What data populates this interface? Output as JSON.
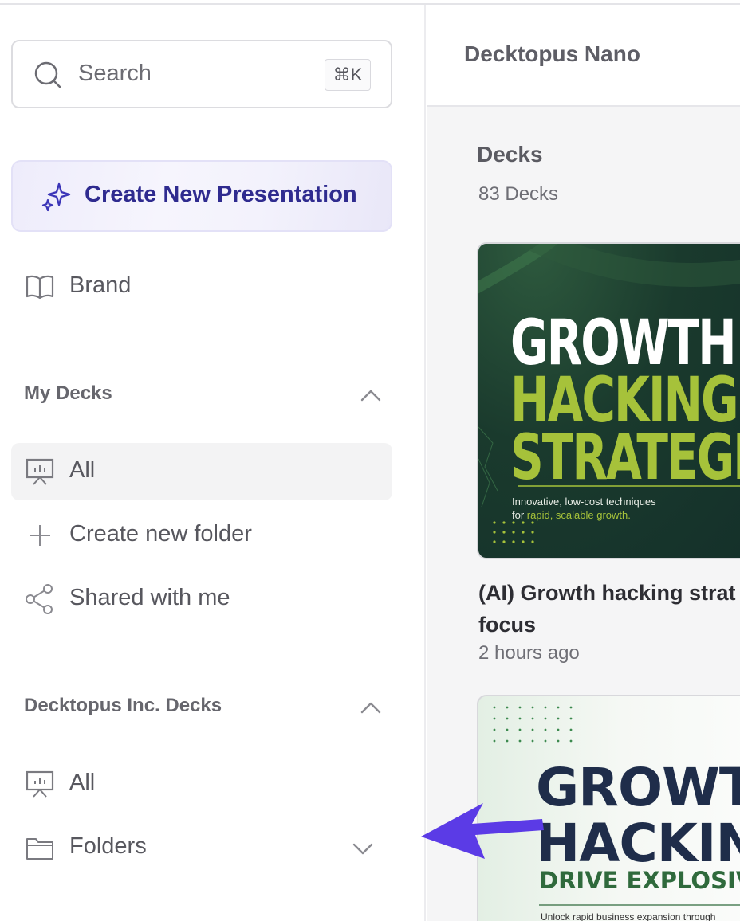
{
  "sidebar": {
    "search": {
      "placeholder": "Search",
      "shortcut": "⌘K"
    },
    "create_button": "Create New Presentation",
    "brand_label": "Brand",
    "my_decks": {
      "title": "My Decks",
      "items": [
        {
          "label": "All",
          "active": true,
          "icon": "presentation-icon"
        },
        {
          "label": "Create new folder",
          "icon": "plus-icon"
        },
        {
          "label": "Shared with me",
          "icon": "share-icon"
        }
      ]
    },
    "team_decks": {
      "title": "Decktopus Inc. Decks",
      "items": [
        {
          "label": "All",
          "icon": "presentation-icon"
        },
        {
          "label": "Folders",
          "icon": "folder-icon"
        }
      ]
    }
  },
  "main": {
    "workspace_name": "Decktopus Nano",
    "section_title": "Decks",
    "deck_count": "83 Decks",
    "decks": [
      {
        "title_line1": "(AI) Growth hacking strat",
        "title_line2": "focus",
        "time": "2 hours ago",
        "thumb": {
          "line1": "GROWTH",
          "line2": "HACKING",
          "line3": "STRATEGIES",
          "sub1": "Innovative, low-cost techniques",
          "sub2a": "for ",
          "sub2b": "rapid, scalable growth."
        }
      },
      {
        "thumb": {
          "line1": "GROWT",
          "line2": "HACKIN",
          "line3": "DRIVE EXPLOSIVE",
          "sub1": "Unlock rapid business expansion through"
        }
      }
    ]
  },
  "colors": {
    "accent": "#2f2b8f",
    "arrow": "#5b3be6",
    "lime": "#a6c23a",
    "navy": "#1f2d4a",
    "dark_green": "#2f6a3c"
  }
}
